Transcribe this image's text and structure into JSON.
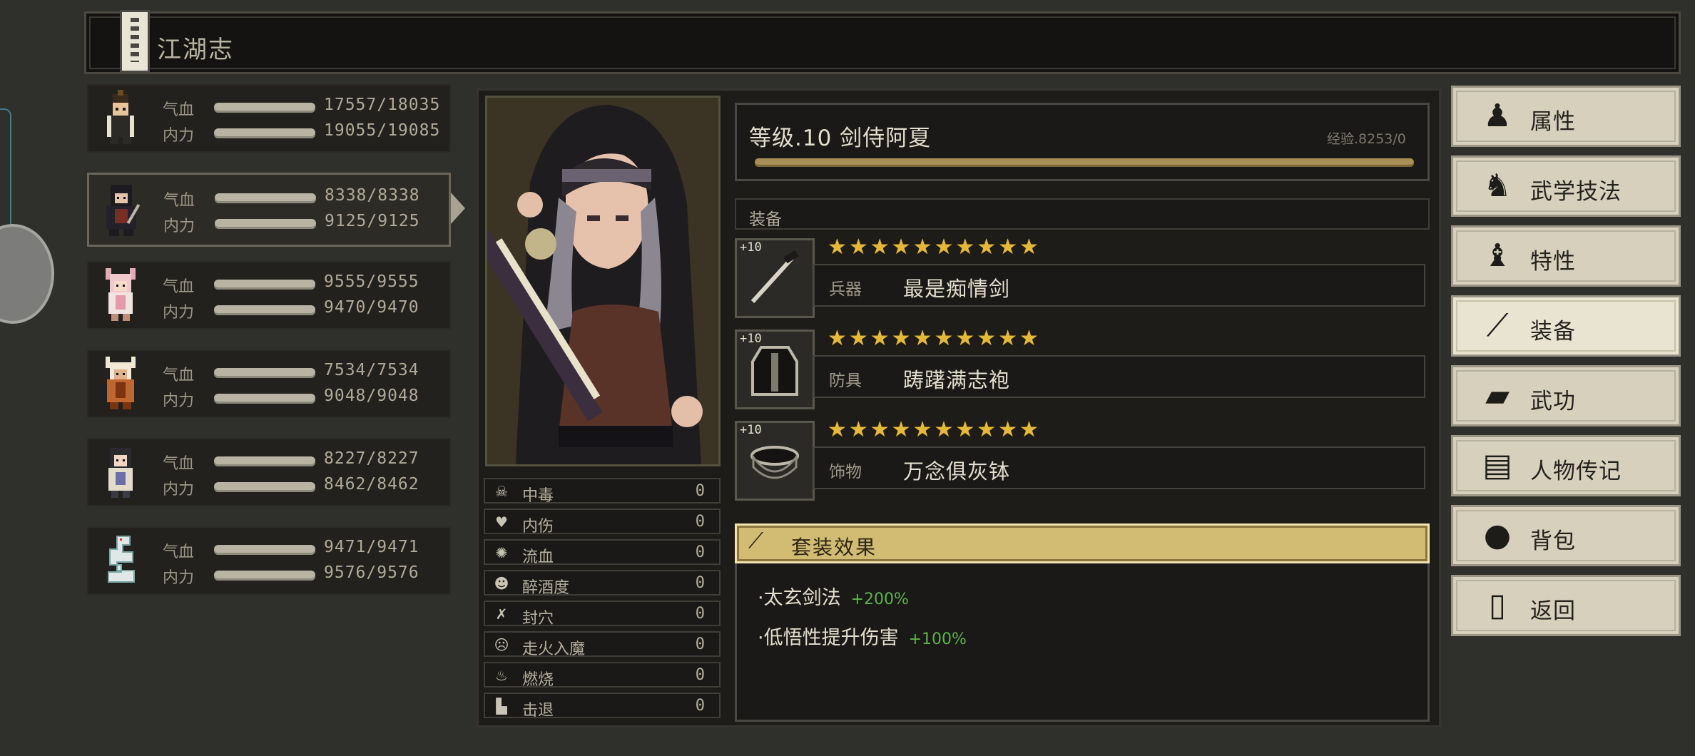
{
  "window": {
    "title": "江湖志"
  },
  "party": [
    {
      "hp_label": "气血",
      "mp_label": "内力",
      "hp": "17557/18035",
      "mp": "19055/19085"
    },
    {
      "hp_label": "气血",
      "mp_label": "内力",
      "hp": "8338/8338",
      "mp": "9125/9125"
    },
    {
      "hp_label": "气血",
      "mp_label": "内力",
      "hp": "9555/9555",
      "mp": "9470/9470"
    },
    {
      "hp_label": "气血",
      "mp_label": "内力",
      "hp": "7534/7534",
      "mp": "9048/9048"
    },
    {
      "hp_label": "气血",
      "mp_label": "内力",
      "hp": "8227/8227",
      "mp": "8462/8462"
    },
    {
      "hp_label": "气血",
      "mp_label": "内力",
      "hp": "9471/9471",
      "mp": "9576/9576"
    }
  ],
  "selected_index": 1,
  "character": {
    "level_title": "等级.10 剑侍阿夏",
    "exp_text": "经验.8253/0"
  },
  "equipment": {
    "header": "装备",
    "items": [
      {
        "plus": "+10",
        "slot": "兵器",
        "name": "最是痴情剑",
        "stars": "★★★★★★★★★★",
        "icon": "sword-icon"
      },
      {
        "plus": "+10",
        "slot": "防具",
        "name": "踌躇满志袍",
        "stars": "★★★★★★★★★★",
        "icon": "robe-icon"
      },
      {
        "plus": "+10",
        "slot": "饰物",
        "name": "万念俱灰钵",
        "stars": "★★★★★★★★★★",
        "icon": "bowl-icon"
      }
    ]
  },
  "set_effect": {
    "title": "套装效果",
    "lines": [
      {
        "text": "·太玄剑法",
        "bonus": "+200%"
      },
      {
        "text": "·低悟性提升伤害",
        "bonus": "+100%"
      }
    ]
  },
  "status_effects": [
    {
      "label": "中毒",
      "value": "0",
      "icon": "skull-icon"
    },
    {
      "label": "内伤",
      "value": "0",
      "icon": "broken-heart-icon"
    },
    {
      "label": "流血",
      "value": "0",
      "icon": "blood-icon"
    },
    {
      "label": "醉酒度",
      "value": "0",
      "icon": "drunk-icon"
    },
    {
      "label": "封穴",
      "value": "0",
      "icon": "seal-icon"
    },
    {
      "label": "走火入魔",
      "value": "0",
      "icon": "demon-icon"
    },
    {
      "label": "燃烧",
      "value": "0",
      "icon": "fire-icon"
    },
    {
      "label": "击退",
      "value": "0",
      "icon": "boot-icon"
    }
  ],
  "menu": [
    {
      "label": "属性",
      "icon": "person-icon"
    },
    {
      "label": "武学技法",
      "icon": "martial-person-icon"
    },
    {
      "label": "特性",
      "icon": "trait-person-icon"
    },
    {
      "label": "装备",
      "icon": "sword-icon"
    },
    {
      "label": "武功",
      "icon": "book-icon"
    },
    {
      "label": "人物传记",
      "icon": "scroll-icon"
    },
    {
      "label": "背包",
      "icon": "bag-icon"
    },
    {
      "label": "返回",
      "icon": "door-icon"
    }
  ],
  "active_menu": 3,
  "colors": {
    "accent_gold": "#d2bb72",
    "bonus_green": "#5db34a",
    "star_gold": "#e4b93a"
  }
}
